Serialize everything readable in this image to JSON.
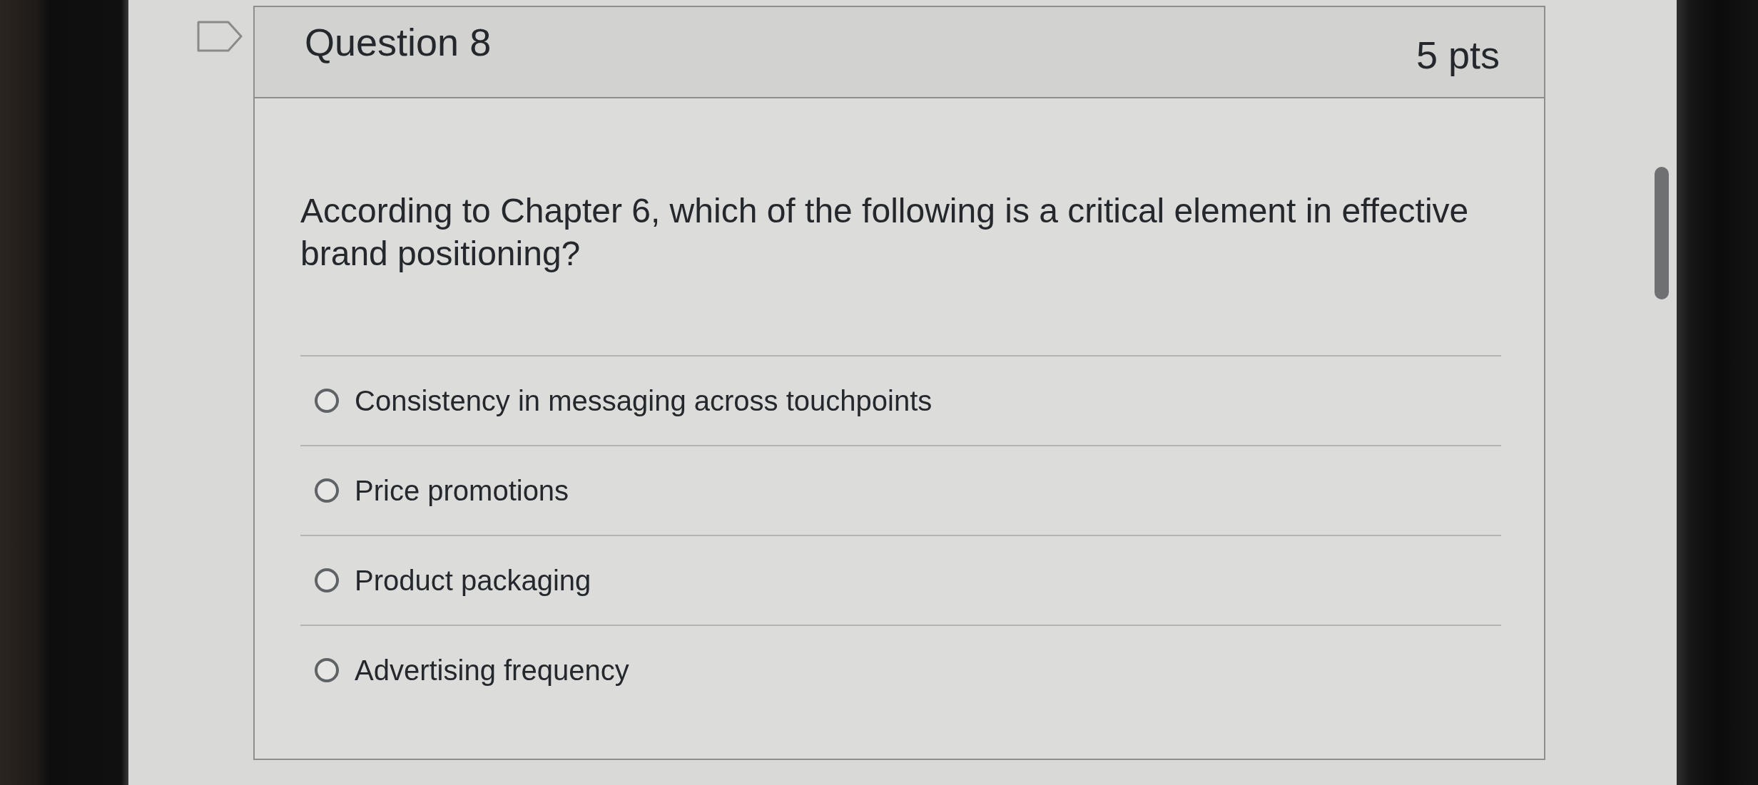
{
  "question": {
    "title": "Question 8",
    "points": "5 pts",
    "text": "According to Chapter 6, which of the following is a critical element in effective brand positioning?"
  },
  "answers": [
    {
      "label": "Consistency in messaging across touchpoints",
      "selected": false
    },
    {
      "label": "Price promotions",
      "selected": false
    },
    {
      "label": "Product packaging",
      "selected": false
    },
    {
      "label": "Advertising frequency",
      "selected": false
    }
  ]
}
